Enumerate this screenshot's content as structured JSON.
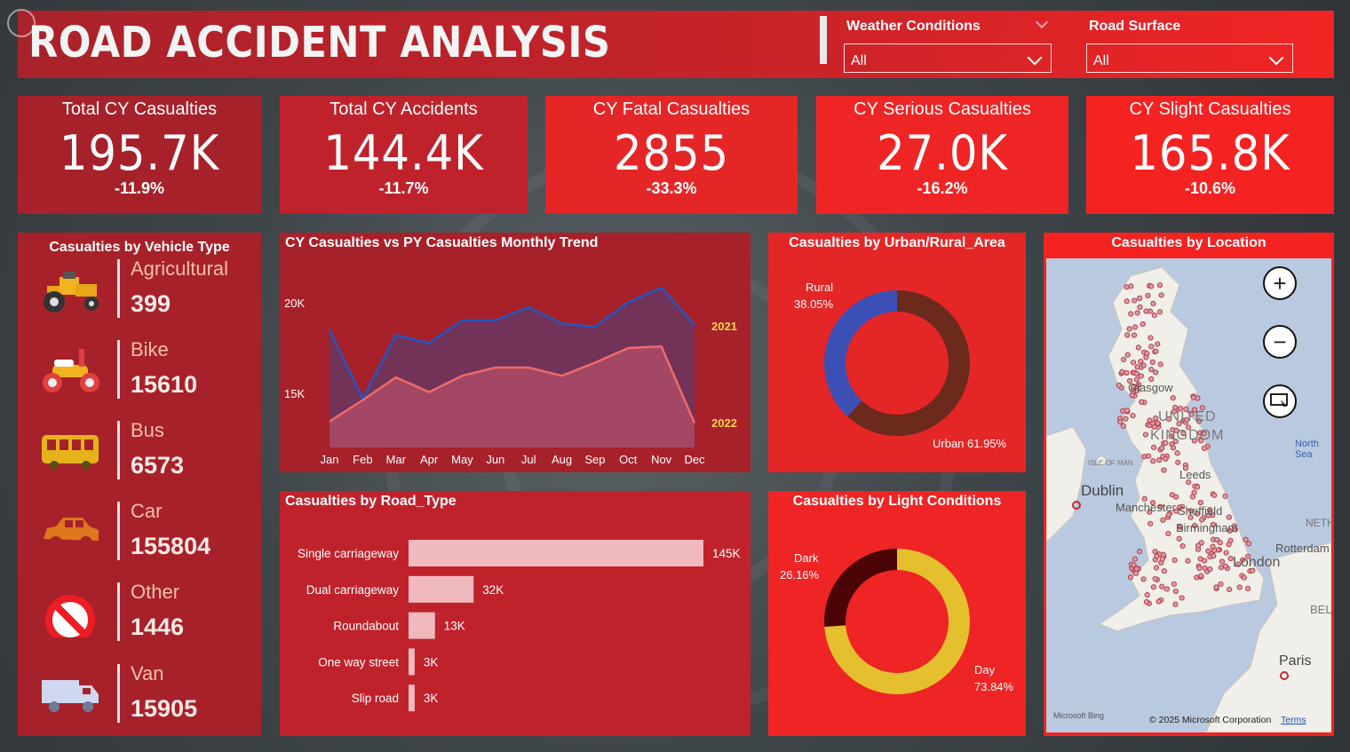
{
  "header": {
    "title": "ROAD ACCIDENT ANALYSIS",
    "weather": {
      "label": "Weather Conditions",
      "value": "All"
    },
    "road_surface": {
      "label": "Road Surface",
      "value": "All"
    }
  },
  "kpis": [
    {
      "title": "Total CY Casualties",
      "value": "195.7K",
      "change": "-11.9%"
    },
    {
      "title": "Total CY Accidents",
      "value": "144.4K",
      "change": "-11.7%"
    },
    {
      "title": "CY Fatal Casualties",
      "value": "2855",
      "change": "-33.3%"
    },
    {
      "title": "CY Serious Casualties",
      "value": "27.0K",
      "change": "-16.2%"
    },
    {
      "title": "CY Slight Casualties",
      "value": "165.8K",
      "change": "-10.6%"
    }
  ],
  "vehicle": {
    "title": "Casualties by Vehicle Type",
    "items": [
      {
        "name": "Agricultural",
        "value": "399",
        "icon": "tractor-icon"
      },
      {
        "name": "Bike",
        "value": "15610",
        "icon": "motorbike-icon"
      },
      {
        "name": "Bus",
        "value": "6573",
        "icon": "bus-icon"
      },
      {
        "name": "Car",
        "value": "155804",
        "icon": "car-icon"
      },
      {
        "name": "Other",
        "value": "1446",
        "icon": "no-entry-icon"
      },
      {
        "name": "Van",
        "value": "15905",
        "icon": "van-icon"
      }
    ]
  },
  "trend": {
    "title": "CY Casualties vs PY Casualties Monthly Trend",
    "series_labels": {
      "cy": "2021",
      "py": "2022"
    },
    "y_ticks": [
      "20K",
      "15K"
    ]
  },
  "urban": {
    "title": "Casualties by Urban/Rural_Area",
    "rural_label": "Rural",
    "rural_pct": "38.05%",
    "urban_label": "Urban 61.95%"
  },
  "roadtype": {
    "title": "Casualties by Road_Type"
  },
  "light": {
    "title": "Casualties by Light Conditions",
    "dark_label": "Dark",
    "dark_pct": "26.16%",
    "day_label": "Day",
    "day_pct": "73.84%"
  },
  "map": {
    "title": "Casualties by Location",
    "places": [
      "Glasgow",
      "UNITED",
      "KINGDOM",
      "Dublin",
      "Manchester",
      "Leeds",
      "Sheffield",
      "Birmingham",
      "London",
      "Paris",
      "Rotterdam",
      "North Sea",
      "ISLE OF MAN",
      "BEL",
      "NETH"
    ],
    "credit": "© 2025 Microsoft Corporation",
    "terms": "Terms",
    "bing": "Microsoft Bing"
  },
  "colors": {
    "cy_line": "#2457c5",
    "py_line": "#ee6b6b",
    "rural": "#3c4fb4",
    "urban": "#6b2a1c",
    "dark": "#4a0405",
    "day": "#e4bf2e",
    "bar": "#f0b9bd"
  },
  "chart_data": [
    {
      "type": "area",
      "title": "CY Casualties vs PY Casualties Monthly Trend",
      "categories": [
        "Jan",
        "Feb",
        "Mar",
        "Apr",
        "May",
        "Jun",
        "Jul",
        "Aug",
        "Sep",
        "Oct",
        "Nov",
        "Dec"
      ],
      "series": [
        {
          "name": "2021",
          "values": [
            18200,
            14000,
            17900,
            17400,
            18800,
            18800,
            19600,
            18600,
            18400,
            19900,
            20800,
            18500
          ]
        },
        {
          "name": "2022",
          "values": [
            12600,
            13900,
            15300,
            14400,
            15400,
            15900,
            15900,
            15400,
            16200,
            17100,
            17200,
            12500
          ]
        }
      ],
      "ylim": [
        11000,
        22000
      ],
      "y_ticks": [
        20000,
        15000
      ]
    },
    {
      "type": "bar",
      "title": "Casualties by Road_Type",
      "categories": [
        "Single carriageway",
        "Dual carriageway",
        "Roundabout",
        "One way street",
        "Slip road"
      ],
      "values": [
        145000,
        32000,
        13000,
        3000,
        3000
      ],
      "value_labels": [
        "145K",
        "32K",
        "13K",
        "3K",
        "3K"
      ]
    },
    {
      "type": "pie",
      "title": "Casualties by Urban/Rural_Area",
      "categories": [
        "Rural",
        "Urban"
      ],
      "values": [
        38.05,
        61.95
      ]
    },
    {
      "type": "pie",
      "title": "Casualties by Light Conditions",
      "categories": [
        "Dark",
        "Day"
      ],
      "values": [
        26.16,
        73.84
      ]
    }
  ]
}
